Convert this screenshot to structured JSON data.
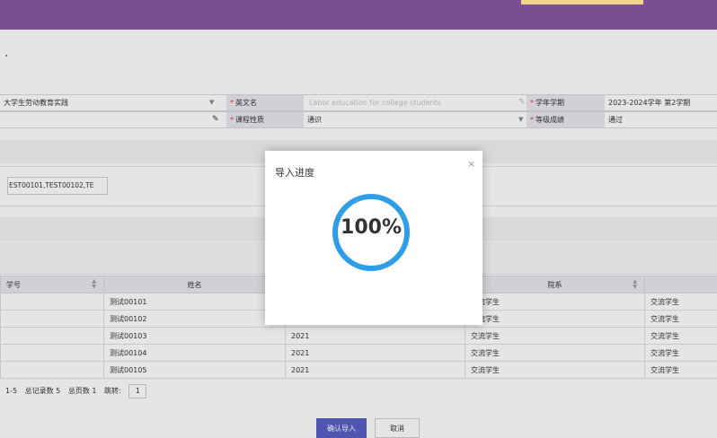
{
  "colors": {
    "header": "#7a4f92",
    "header_accent": "#f1d38a",
    "label_bg": "#ebe7ef",
    "required": "#e0403a",
    "primary_button": "#5b5fc7",
    "progress_ring": "#2f9ee9"
  },
  "form": {
    "row1": {
      "course_value": "大学生劳动教育实践",
      "english_label": "英文名",
      "english_placeholder": "Labor education for college students",
      "term_label": "学年学期",
      "term_value": "2023-2024学年 第2学期"
    },
    "row2": {
      "nature_label": "课程性质",
      "nature_value": "通识",
      "grade_label": "等级成绩",
      "grade_value": "通过"
    }
  },
  "student_ids": "EST00101,TEST00102,TE",
  "table": {
    "headers": [
      "学号",
      "姓名",
      "",
      "院系",
      ""
    ],
    "rows": [
      {
        "name": "测试00101",
        "year": "",
        "type": "交流学生",
        "last": "交流学生"
      },
      {
        "name": "测试00102",
        "year": "",
        "type": "交流学生",
        "last": "交流学生"
      },
      {
        "name": "测试00103",
        "year": "2021",
        "type": "交流学生",
        "last": "交流学生"
      },
      {
        "name": "测试00104",
        "year": "2021",
        "type": "交流学生",
        "last": "交流学生"
      },
      {
        "name": "测试00105",
        "year": "2021",
        "type": "交流学生",
        "last": "交流学生"
      }
    ]
  },
  "pager": {
    "range": "1-5",
    "total_records": "总记录数 5",
    "total_pages": "总页数 1",
    "jump_label": "跳转:",
    "jump_value": "1"
  },
  "buttons": {
    "confirm": "确认导入",
    "cancel": "取消"
  },
  "modal": {
    "title": "导入进度",
    "close": "×",
    "progress_text": "100%",
    "progress_value": 1.0
  },
  "icons": {
    "dropdown": "caret-down-icon",
    "edit": "pencil-icon",
    "sort": "sort-icon",
    "close": "close-icon"
  }
}
